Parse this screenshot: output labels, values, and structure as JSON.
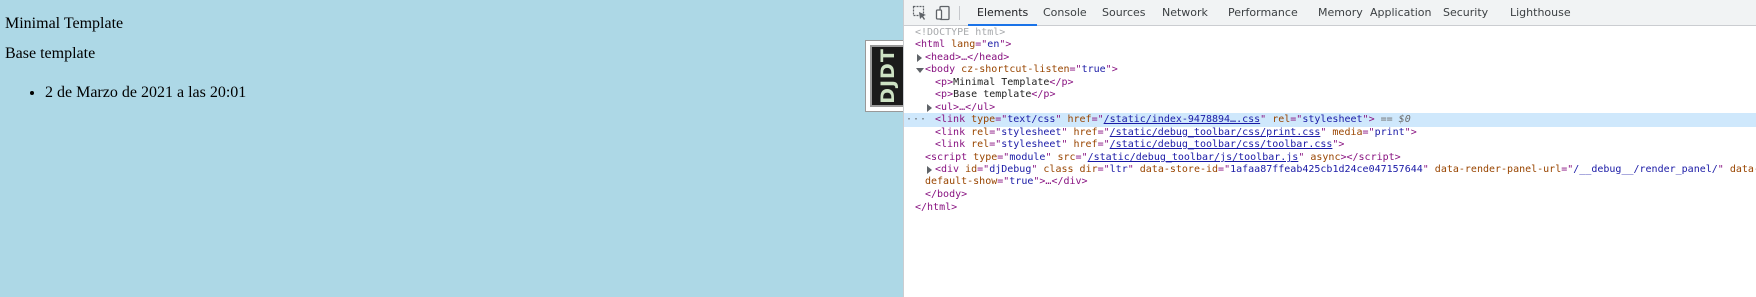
{
  "page": {
    "paragraphs": [
      "Minimal Template",
      "Base template"
    ],
    "list_items": [
      "2 de Marzo de 2021 a las 20:01"
    ],
    "background_color": "#add8e6",
    "djdt_logo": "DJDT"
  },
  "devtools": {
    "tabs": [
      {
        "label": "Elements",
        "active": true
      },
      {
        "label": "Console",
        "active": false
      },
      {
        "label": "Sources",
        "active": false
      },
      {
        "label": "Network",
        "active": false
      },
      {
        "label": "Performance",
        "active": false
      },
      {
        "label": "Memory",
        "active": false
      },
      {
        "label": "Application",
        "active": false
      },
      {
        "label": "Security",
        "active": false
      },
      {
        "label": "Lighthouse",
        "active": false
      }
    ],
    "accent_color": "#1a73e8",
    "dom": {
      "doctype": "<!DOCTYPE html>",
      "html_open": {
        "tag": "html",
        "attr": "lang",
        "value": "en"
      },
      "head_collapsed": "<head>…</head>",
      "body_open": {
        "tag": "body",
        "attr": "cz-shortcut-listen",
        "value": "true"
      },
      "p1": {
        "tag": "p",
        "text": "Minimal Template"
      },
      "p2": {
        "tag": "p",
        "text": "Base template"
      },
      "ul_collapsed": "<ul>…</ul>",
      "selected_marker": "== $0",
      "link1": {
        "type": "text/css",
        "href": "/static/index-9478894….css",
        "rel": "stylesheet"
      },
      "link2": {
        "rel": "stylesheet",
        "href": "/static/debug_toolbar/css/print.css",
        "media": "print"
      },
      "link3": {
        "rel": "stylesheet",
        "href": "/static/debug_toolbar/css/toolbar.css"
      },
      "script": {
        "type": "module",
        "src": "/static/debug_toolbar/js/toolbar.js",
        "flag": "async"
      },
      "div": {
        "id": "djDebug",
        "class": "",
        "dir": "ltr",
        "data_store_id": "1afaa87ffeab425cb1d24ce047157644",
        "data_render_panel_url": "/__debug__/render_panel/",
        "data_default_show": "true"
      },
      "body_close": "</body>",
      "html_close": "</html>"
    }
  }
}
